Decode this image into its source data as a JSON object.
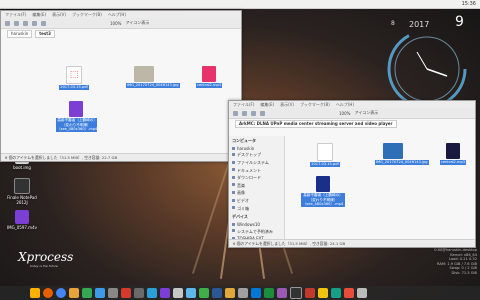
{
  "topbar": {
    "clock": "15:36"
  },
  "desktop": {
    "icons": [
      {
        "label": "boot.img"
      },
      {
        "label": "Finale NotePad 2012J"
      },
      {
        "label": "IMG_0597.m4v"
      }
    ],
    "logo": "Xprocess",
    "logo_sub": "today is the future"
  },
  "clock_widget": {
    "year": "2017",
    "day": "9",
    "month": "8"
  },
  "window1": {
    "menu": [
      "ファイル(F)",
      "編集(E)",
      "表示(V)",
      "ブックマーク(B)",
      "ヘルプ(H)"
    ],
    "tab": "test3",
    "path": [
      "haruskin",
      "test3"
    ],
    "zoom": "100%",
    "view": "アイコン表示",
    "files": [
      {
        "name": "2017.03.15.pdf",
        "type": "pdf"
      },
      {
        "name": "IMG_20170724_0046143.jpg",
        "type": "image"
      },
      {
        "name": "central2.mp3",
        "type": "audio"
      },
      {
        "name": "高齢不審者（上鶴崎の）（変わり不明様）（see_480x360）.mp4",
        "type": "video"
      }
    ],
    "status": "6 個のアイテムを選択しました（31.5 MiB）, 空き容量: 22.7 GB"
  },
  "window2": {
    "menu": [
      "ファイル(F)",
      "編集(E)",
      "表示(V)",
      "ブックマーク(B)",
      "ヘルプ(H)"
    ],
    "tab": "test3",
    "path": [
      "ArkMC: DLNA UPnP media center streaming server and video player"
    ],
    "zoom": "100%",
    "view": "アイコン表示",
    "sidebar": {
      "computer_header": "コンピュータ",
      "computer_items": [
        "haruskin",
        "デスクトップ",
        "ファイルシステム",
        "ドキュメント",
        "ダウンロード",
        "音楽",
        "画像",
        "ビデオ",
        "ゴミ箱"
      ],
      "devices_header": "デバイス",
      "device_items": [
        "Windows10",
        "システムで予約済み",
        "TOSHIBA EXT"
      ]
    },
    "files": [
      {
        "name": "2017.03.15.pdf",
        "type": "pdf"
      },
      {
        "name": "IMG_20170724_0046143.jpg",
        "type": "image"
      },
      {
        "name": "central2.mp3",
        "type": "audio"
      },
      {
        "name": "高齢不審者（上鶴崎の）（変わり不明様）（see_480x360）.mp4",
        "type": "video"
      }
    ],
    "status": "6 個のアイテムを選択しました（31.5 MiB）, 空き容量: 24.1 GB"
  },
  "sysinfo": [
    "0:00@haruskin-desktop",
    "Kernel: x86_64",
    "Load: 0.21 0.32",
    "RAM: 1.9 GiB / 7.6 GiB",
    "Swap: 0 / 2 GiB",
    "Disk: 71.5 GiB"
  ],
  "colors": {
    "selection": "#3d7edc",
    "pdf": "#d33a2c",
    "audio": "#e6336b",
    "video": "#7b3fd6",
    "clock_accent": "#5fb8ea"
  }
}
